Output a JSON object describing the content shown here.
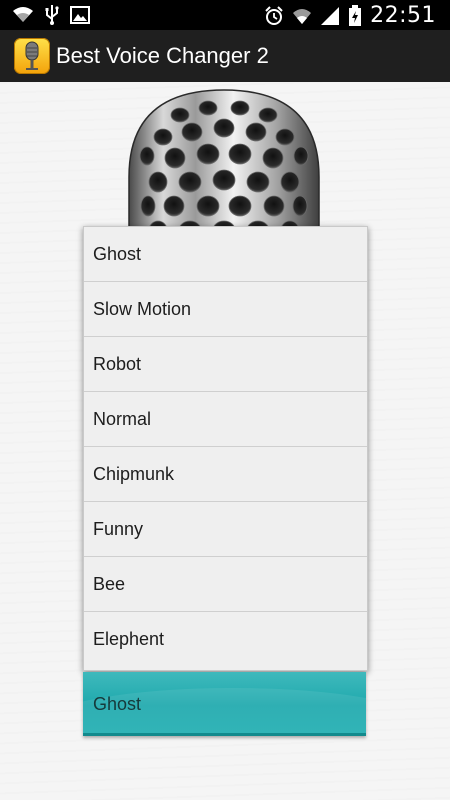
{
  "status_bar": {
    "time": "22:51",
    "icons": [
      "wifi-icon",
      "usb-icon",
      "image-icon",
      "alarm-icon",
      "wifi-signal-icon",
      "cell-signal-icon",
      "battery-icon"
    ]
  },
  "action_bar": {
    "title": "Best Voice Changer 2",
    "icon": "microphone-app-icon"
  },
  "voice_menu": {
    "options": [
      "Ghost",
      "Slow Motion",
      "Robot",
      "Normal",
      "Chipmunk",
      "Funny",
      "Bee",
      "Elephent"
    ]
  },
  "spinner": {
    "selected": "Ghost"
  },
  "colors": {
    "action_bar_bg": "#1f1f1f",
    "spinner_bg": "#1ea9ad",
    "menu_bg": "#efefef"
  }
}
